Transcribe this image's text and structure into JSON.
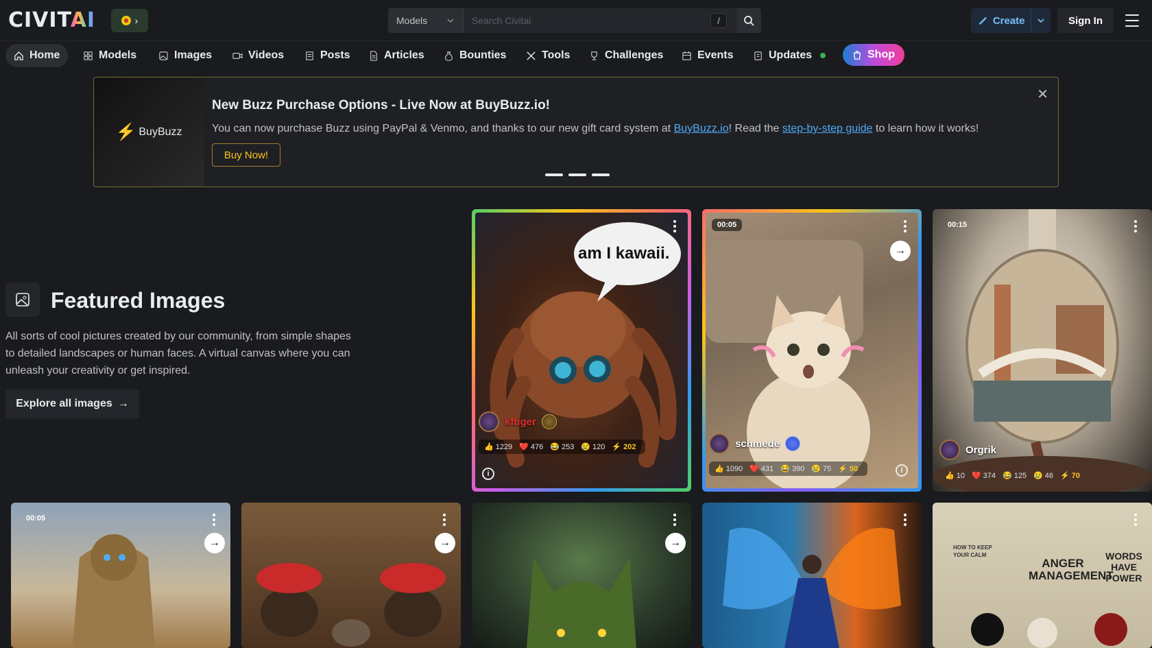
{
  "header": {
    "logo_main": "CIVIT",
    "logo_accent": "AI",
    "region_caret": "›",
    "search": {
      "category": "Models",
      "placeholder": "Search Civitai",
      "shortcut": "/"
    },
    "create_label": "Create",
    "signin_label": "Sign In"
  },
  "nav": {
    "items": [
      {
        "label": "Home",
        "icon": "home-icon"
      },
      {
        "label": "Models",
        "icon": "grid-icon"
      },
      {
        "label": "Images",
        "icon": "image-icon"
      },
      {
        "label": "Videos",
        "icon": "video-icon"
      },
      {
        "label": "Posts",
        "icon": "posts-icon"
      },
      {
        "label": "Articles",
        "icon": "article-icon"
      },
      {
        "label": "Bounties",
        "icon": "moneybag-icon"
      },
      {
        "label": "Tools",
        "icon": "tools-icon"
      },
      {
        "label": "Challenges",
        "icon": "trophy-icon"
      },
      {
        "label": "Events",
        "icon": "calendar-icon"
      },
      {
        "label": "Updates",
        "icon": "updates-icon"
      }
    ],
    "shop_label": "Shop",
    "accent_colors": [
      "#1c7ed6",
      "#be4bdb",
      "#f03e9b"
    ]
  },
  "banner": {
    "image_label": "BuyBuzz",
    "title": "New Buzz Purchase Options - Live Now at BuyBuzz.io!",
    "text_1": "You can now purchase Buzz using PayPal & Venmo, and thanks to our new gift card system at ",
    "link_1": "BuyBuzz.io",
    "text_2": "! Read the ",
    "link_2": "step-by-step guide",
    "text_3": " to learn how it works!",
    "button_label": "Buy Now!",
    "close_glyph": "✕"
  },
  "featured": {
    "title": "Featured Images",
    "description": "All sorts of cool pictures created by our community, from simple shapes to detailed landscapes or human faces. A virtual canvas where you can unleash your creativity or get inspired.",
    "explore_label": "Explore all images"
  },
  "cards": [
    {
      "user": "kftiger",
      "speech": "am I kawaii.",
      "likes": "1229",
      "hearts": "476",
      "laughs": "253",
      "cries": "120",
      "buzz": "202"
    },
    {
      "user": "schmede",
      "time": "00:05",
      "likes": "1090",
      "hearts": "431",
      "laughs": "390",
      "cries": "75",
      "buzz": "50"
    },
    {
      "user": "Orgrik",
      "time": "00:15",
      "likes": "10",
      "hearts": "374",
      "laughs": "125",
      "cries": "46",
      "buzz": "70"
    }
  ],
  "bottom_cards": [
    {
      "time": "00:05"
    },
    {
      "time": ""
    },
    {
      "time": ""
    },
    {
      "time": ""
    },
    {
      "sign_left": "HOW TO KEEP YOUR CALM",
      "sign_mid": "ANGER MANAGEMENT",
      "sign_right": "WORDS HAVE POWER"
    }
  ]
}
